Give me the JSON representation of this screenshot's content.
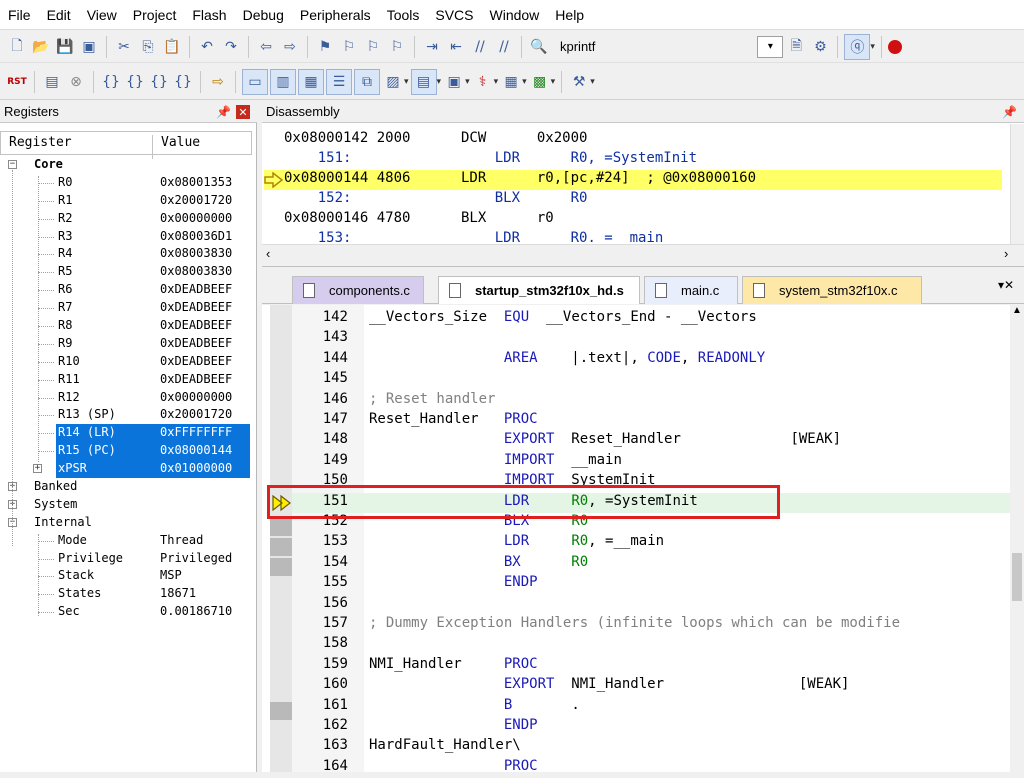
{
  "menu": [
    "File",
    "Edit",
    "View",
    "Project",
    "Flash",
    "Debug",
    "Peripherals",
    "Tools",
    "SVCS",
    "Window",
    "Help"
  ],
  "toolbar": {
    "find_text": "kprintf",
    "rst_label": "RST"
  },
  "registers": {
    "title": "Registers",
    "col_register": "Register",
    "col_value": "Value",
    "core_label": "Core",
    "rows": [
      {
        "name": "R0",
        "value": "0x08001353"
      },
      {
        "name": "R1",
        "value": "0x20001720"
      },
      {
        "name": "R2",
        "value": "0x00000000"
      },
      {
        "name": "R3",
        "value": "0x080036D1"
      },
      {
        "name": "R4",
        "value": "0x08003830"
      },
      {
        "name": "R5",
        "value": "0x08003830"
      },
      {
        "name": "R6",
        "value": "0xDEADBEEF"
      },
      {
        "name": "R7",
        "value": "0xDEADBEEF"
      },
      {
        "name": "R8",
        "value": "0xDEADBEEF"
      },
      {
        "name": "R9",
        "value": "0xDEADBEEF"
      },
      {
        "name": "R10",
        "value": "0xDEADBEEF"
      },
      {
        "name": "R11",
        "value": "0xDEADBEEF"
      },
      {
        "name": "R12",
        "value": "0x00000000"
      },
      {
        "name": "R13 (SP)",
        "value": "0x20001720"
      },
      {
        "name": "R14 (LR)",
        "value": "0xFFFFFFFF"
      },
      {
        "name": "R15 (PC)",
        "value": "0x08000144"
      },
      {
        "name": "xPSR",
        "value": "0x01000000"
      }
    ],
    "groups": [
      "Banked",
      "System",
      "Internal"
    ],
    "internal": [
      {
        "name": "Mode",
        "value": "Thread"
      },
      {
        "name": "Privilege",
        "value": "Privileged"
      },
      {
        "name": "Stack",
        "value": "MSP"
      },
      {
        "name": "States",
        "value": "18671"
      },
      {
        "name": "Sec",
        "value": "0.00186710"
      }
    ]
  },
  "disassembly": {
    "title": "Disassembly",
    "lines": [
      "0x08000142 2000      DCW      0x2000",
      "    151:                 LDR      R0, =SystemInit",
      "0x08000144 4806      LDR      r0,[pc,#24]  ; @0x08000160",
      "    152:                 BLX      R0",
      "0x08000146 4780      BLX      r0",
      "    153:                 LDR      R0, =__main"
    ]
  },
  "tabs": [
    "components.c",
    "startup_stm32f10x_hd.s",
    "main.c",
    "system_stm32f10x.c"
  ],
  "editor": {
    "lines": [
      {
        "n": "142",
        "t": "__Vectors_Size  EQU  __Vectors_End - __Vectors"
      },
      {
        "n": "143",
        "t": ""
      },
      {
        "n": "144",
        "t": "                AREA    |.text|, CODE, READONLY"
      },
      {
        "n": "145",
        "t": ""
      },
      {
        "n": "146",
        "t": "; Reset handler"
      },
      {
        "n": "147",
        "t": "Reset_Handler   PROC"
      },
      {
        "n": "148",
        "t": "                EXPORT  Reset_Handler             [WEAK]"
      },
      {
        "n": "149",
        "t": "                IMPORT  __main"
      },
      {
        "n": "150",
        "t": "                IMPORT  SystemInit"
      },
      {
        "n": "151",
        "t": "                LDR     R0, =SystemInit"
      },
      {
        "n": "152",
        "t": "                BLX     R0"
      },
      {
        "n": "153",
        "t": "                LDR     R0, =__main"
      },
      {
        "n": "154",
        "t": "                BX      R0"
      },
      {
        "n": "155",
        "t": "                ENDP"
      },
      {
        "n": "156",
        "t": ""
      },
      {
        "n": "157",
        "t": "; Dummy Exception Handlers (infinite loops which can be modifie"
      },
      {
        "n": "158",
        "t": ""
      },
      {
        "n": "159",
        "t": "NMI_Handler     PROC"
      },
      {
        "n": "160",
        "t": "                EXPORT  NMI_Handler                [WEAK]"
      },
      {
        "n": "161",
        "t": "                B       ."
      },
      {
        "n": "162",
        "t": "                ENDP"
      },
      {
        "n": "163",
        "t": "HardFault_Handler\\"
      },
      {
        "n": "164",
        "t": "                PROC"
      }
    ]
  }
}
